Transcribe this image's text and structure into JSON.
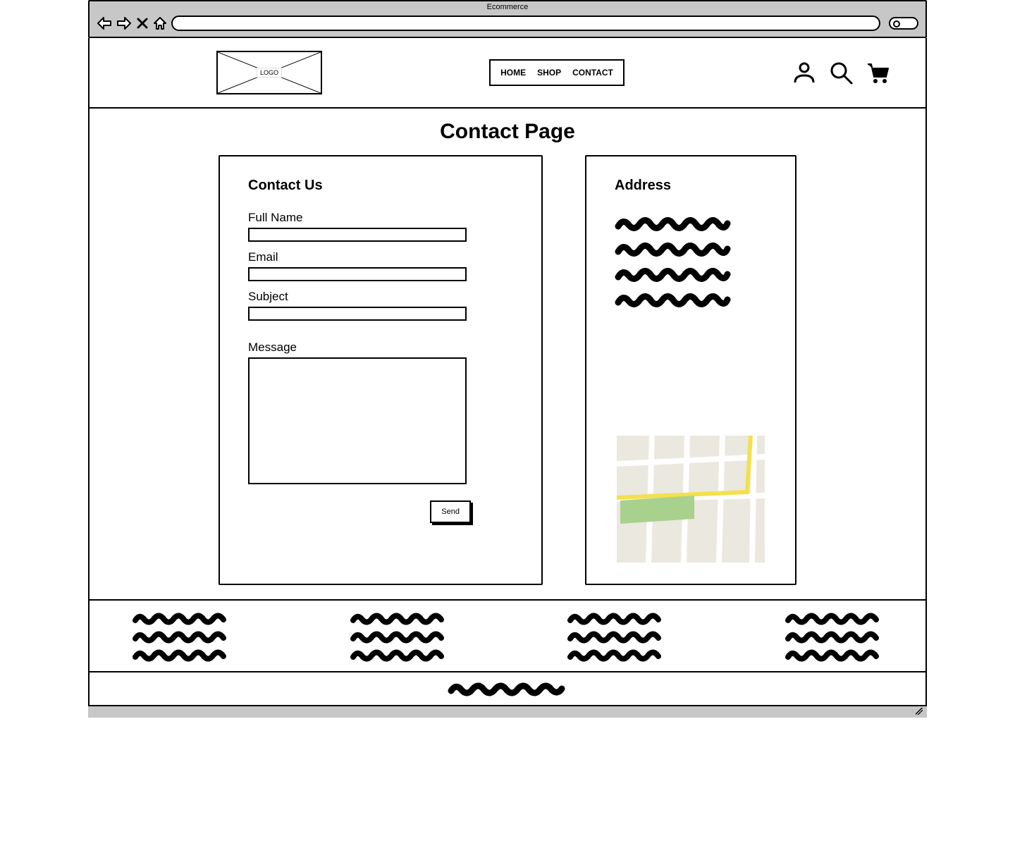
{
  "browser": {
    "title": "Ecommerce"
  },
  "header": {
    "logo_text": "LOGO",
    "nav": {
      "home": "HOME",
      "shop": "SHOP",
      "contact": "CONTACT"
    }
  },
  "page": {
    "title": "Contact Page",
    "form": {
      "heading": "Contact Us",
      "full_name_label": "Full Name",
      "email_label": "Email",
      "subject_label": "Subject",
      "message_label": "Message",
      "send_label": "Send"
    },
    "address": {
      "heading": "Address"
    }
  }
}
